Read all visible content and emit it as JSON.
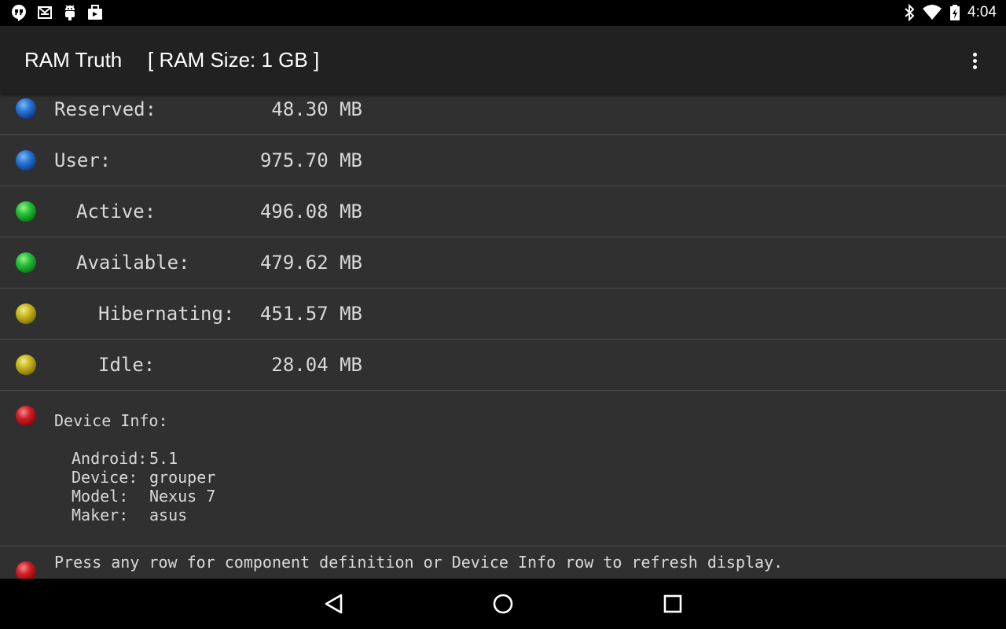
{
  "status_bar": {
    "time": "4:04",
    "left_icons": [
      "hangouts-icon",
      "gmail-icon",
      "android-debug-icon",
      "briefcase-icon"
    ],
    "right_icons": [
      "bluetooth-icon",
      "wifi-icon",
      "battery-charging-icon"
    ]
  },
  "app_bar": {
    "title": "RAM Truth",
    "subtitle": "[ RAM Size: 1 GB ]",
    "overflow_icon": "more-vert-icon"
  },
  "memory_rows": [
    {
      "label": "Reserved:",
      "value": "48.30 MB",
      "indicator": "blue",
      "indent": 0
    },
    {
      "label": "User:",
      "value": "975.70 MB",
      "indicator": "blue",
      "indent": 0
    },
    {
      "label": "Active:",
      "value": "496.08 MB",
      "indicator": "green",
      "indent": 1
    },
    {
      "label": "Available:",
      "value": "479.62 MB",
      "indicator": "green",
      "indent": 1
    },
    {
      "label": "Hibernating:",
      "value": "451.57 MB",
      "indicator": "yellow",
      "indent": 2
    },
    {
      "label": "Idle:",
      "value": "28.04 MB",
      "indicator": "yellow",
      "indent": 2
    }
  ],
  "device_info": {
    "heading": "Device Info:",
    "indicator": "red",
    "rows": [
      {
        "key": "Android:",
        "value": "5.1"
      },
      {
        "key": "Device:",
        "value": "grouper"
      },
      {
        "key": "Model:",
        "value": "Nexus 7"
      },
      {
        "key": "Maker:",
        "value": "asus"
      }
    ]
  },
  "hint": {
    "text": "Press any row for component definition or Device Info row to refresh display.",
    "indicator": "red"
  },
  "nav_bar": {
    "buttons": [
      "back-icon",
      "home-icon",
      "recents-icon"
    ]
  },
  "colors": {
    "status_bar": "#000000",
    "app_bar": "#212121",
    "background": "#303030",
    "divider": "#4a4a4a",
    "text": "#d8d8d8"
  }
}
